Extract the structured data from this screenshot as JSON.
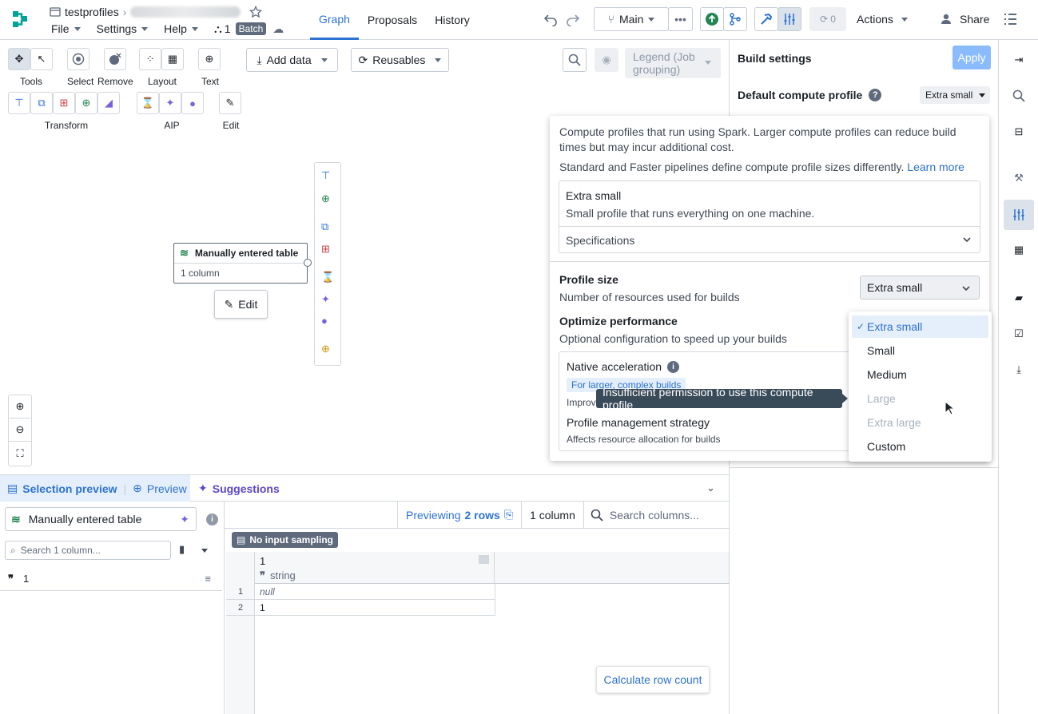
{
  "header": {
    "project": "testprofiles",
    "menus": [
      "File",
      "Settings",
      "Help"
    ],
    "branch_count": "1",
    "mode_badge": "Batch",
    "tabs": [
      "Graph",
      "Proposals",
      "History"
    ],
    "branch": "Main",
    "sync_count": "0",
    "actions_label": "Actions",
    "share_label": "Share"
  },
  "toolbar": {
    "groups": [
      {
        "label": "Tools"
      },
      {
        "label": "Select"
      },
      {
        "label": "Remove"
      },
      {
        "label": "Layout"
      },
      {
        "label": "Text"
      }
    ],
    "row2_labels": [
      "Transform",
      "AIP",
      "Edit"
    ],
    "add_data": "Add data",
    "reusables": "Reusables",
    "legend": "Legend (Job grouping)"
  },
  "node": {
    "title": "Manually entered table",
    "subtitle": "1 column",
    "edit_label": "Edit"
  },
  "build_settings": {
    "title": "Build settings",
    "apply_label": "Apply",
    "default_profile_label": "Default compute profile",
    "default_profile_value": "Extra small"
  },
  "popover": {
    "desc1": "Compute profiles that run using Spark. Larger compute profiles can reduce build times but may incur additional cost.",
    "desc2": "Standard and Faster pipelines define compute profile sizes differently.",
    "learn_more": "Learn more",
    "card_title": "Extra small",
    "card_desc": "Small profile that runs everything on one machine.",
    "specs_label": "Specifications",
    "profile_size_title": "Profile size",
    "profile_size_desc": "Number of resources used for builds",
    "profile_size_value": "Extra small",
    "optimize_title": "Optimize performance",
    "optimize_desc": "Optional configuration to speed up your builds",
    "native_title": "Native acceleration",
    "native_tag": "For larger, complex builds",
    "native_desc_partial": "Improv",
    "strategy_title": "Profile management strategy",
    "strategy_desc": "Affects resource allocation for builds"
  },
  "dropdown": {
    "options": [
      {
        "label": "Extra small",
        "selected": true,
        "disabled": false
      },
      {
        "label": "Small",
        "selected": false,
        "disabled": false
      },
      {
        "label": "Medium",
        "selected": false,
        "disabled": false
      },
      {
        "label": "Large",
        "selected": false,
        "disabled": true
      },
      {
        "label": "Extra large",
        "selected": false,
        "disabled": true
      },
      {
        "label": "Custom",
        "selected": false,
        "disabled": false
      }
    ]
  },
  "tooltip": "Insufficient permission to use this compute profile",
  "bottom": {
    "tabs": [
      "Selection preview",
      "Preview",
      "Suggestions"
    ],
    "dataset_name": "Manually entered table",
    "search_placeholder": "Search 1 column...",
    "column_name": "1",
    "previewing_label": "Previewing",
    "rows_label": "2 rows",
    "columns_label": "1 column",
    "search_columns_placeholder": "Search columns...",
    "sampling_label": "No input sampling",
    "col_header": "1",
    "col_type": "string",
    "rows": [
      {
        "n": "1",
        "v": "null"
      },
      {
        "n": "2",
        "v": "1"
      }
    ],
    "calc_label": "Calculate row count"
  },
  "colors": {
    "accent": "#2d72d2",
    "green": "#238551",
    "purple": "#7961db",
    "pink": "#cd4246",
    "gold": "#d1980b",
    "teal": "#00a396"
  }
}
